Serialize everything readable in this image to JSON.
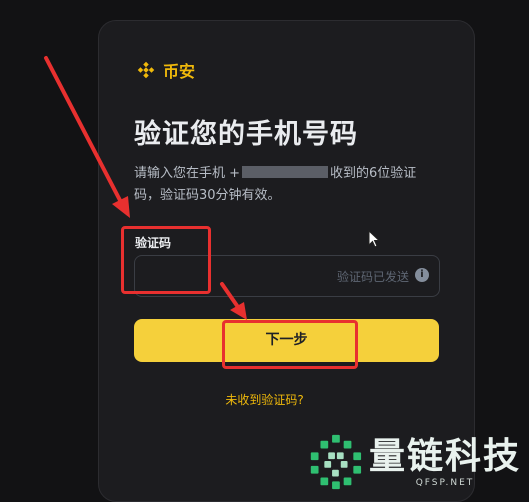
{
  "brand": {
    "name": "币安"
  },
  "page": {
    "title": "验证您的手机号码",
    "desc_prefix": "请输入您在手机 +",
    "desc_suffix": "收到的6位验证码，验证码30分钟有效。"
  },
  "form": {
    "field_label": "验证码",
    "input_value": "",
    "sent_hint": "验证码已发送",
    "next_label": "下一步",
    "resend_label": "未收到验证码?"
  },
  "watermark": {
    "title": "量链科技",
    "site": "QFSP.NET"
  },
  "colors": {
    "accent": "#f0b90b",
    "button": "#f5d03b",
    "annotation": "#e8302f",
    "background": "#121214"
  },
  "icons": [
    "binance-logo-icon",
    "info-icon",
    "cursor-icon",
    "watermark-logo-icon"
  ]
}
